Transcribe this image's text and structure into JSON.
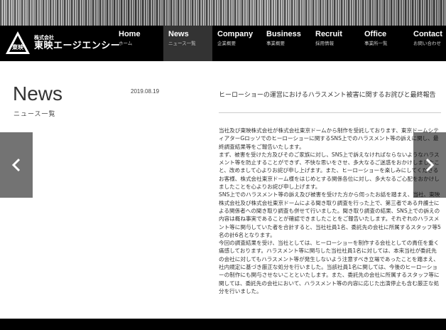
{
  "header": {
    "logo": {
      "small_text": "株式会社",
      "name": "東映エージエンシー",
      "mark_text": "東映"
    },
    "nav": [
      {
        "en": "Home",
        "jp": "ホーム",
        "active": false
      },
      {
        "en": "News",
        "jp": "ニュース一覧",
        "active": true
      },
      {
        "en": "Company",
        "jp": "企業概要",
        "active": false
      },
      {
        "en": "Business",
        "jp": "事業概要",
        "active": false
      },
      {
        "en": "Recruit",
        "jp": "採用情報",
        "active": false
      },
      {
        "en": "Office",
        "jp": "事業所一覧",
        "active": false
      },
      {
        "en": "Contact",
        "jp": "お問い合わせ",
        "active": false
      }
    ]
  },
  "page": {
    "title": "News",
    "subtitle": "ニュース一覧"
  },
  "article": {
    "date": "2019.08.19",
    "title": "ヒーローショーの運営におけるハラスメント被害に関するお詫びと最終報告",
    "paragraphs": [
      "当社及び東映株式会社が株式会社東京ドームから制作を受託しております、東京ドームシティアターGロッソでのヒーローショーに関するSNS上でのハラスメント等の訴えに関し、最終調査結果等をご報告いたします。",
      "まず、被害を受けた方及びそのご家族に対し、SNS上で訴えなければならないようなハラスメント等を防止することができず、不快な思いをさせ、多大なるご迷惑をおかけしましたこと、改めまして心よりお詫び申し上げます。また、ヒーローショーを楽しみにしてくださるお客様、株式会社東京ドーム様をはじめとする関係各位に対し、多大なるご心配をおかけしましたことを心よりお詫び申し上げます。",
      "SNS上でのハラスメント等の訴え及び被害を受けた方から伺ったお話を踏まえ、当社、東映株式会社及び株式会社東京ドームによる聞き取り調査を行った上で、第三者である弁護士による関係者への聞き取り調査も併せて行いました。聞き取り調査の結果、SNS上での訴えの内容は概ね事実であることが確認できましたことをご報告いたします。それぞれのハラスメント等に関与していた者を合計すると、当社社員1名、委託先の会社に所属するスタッフ等5名の計6名となります。",
      "今回の調査結果を受け、当社としては、ヒーローショーを制作する会社としての責任を重く痛感しております。ハラスメント等に関与した当社社員1名に対しては、本来当社が委託先の会社に対してもハラスメント等が発生しないよう注意すべき立場であったことを踏まえ、社内規定に基づき厳正な処分を行いました。当該社員1名に関しては、今後のヒーローショーの制作にも関与させないことといたします。また、委託先の会社に所属するスタッフ等に関しては、委託先の会社において、ハラスメント等の内容に応じた出演停止も含む厳正な処分を行いました。"
    ]
  },
  "controls": {
    "prev_icon": "chevron-left-icon",
    "next_icon": "chevron-right-icon"
  }
}
